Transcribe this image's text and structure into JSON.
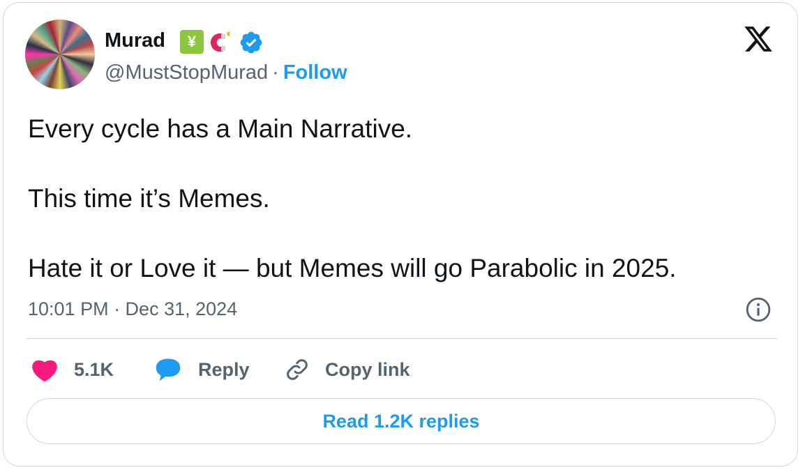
{
  "user": {
    "name": "Murad",
    "handle": "@MustStopMurad",
    "separator": "·",
    "follow_label": "Follow"
  },
  "tweet": {
    "lines": [
      "Every cycle has a Main Narrative.",
      "This time it’s Memes.",
      "Hate it or Love it — but Memes will go Parabolic in 2025."
    ],
    "timestamp": "10:01 PM · Dec 31, 2024"
  },
  "actions": {
    "likes": "5.1K",
    "reply_label": "Reply",
    "copy_link_label": "Copy link"
  },
  "read_replies_label": "Read 1.2K replies",
  "colors": {
    "accent": "#1d9bf0",
    "like": "#f91880",
    "text": "#0f1419",
    "secondary": "#536471",
    "border": "#cfd9de"
  }
}
